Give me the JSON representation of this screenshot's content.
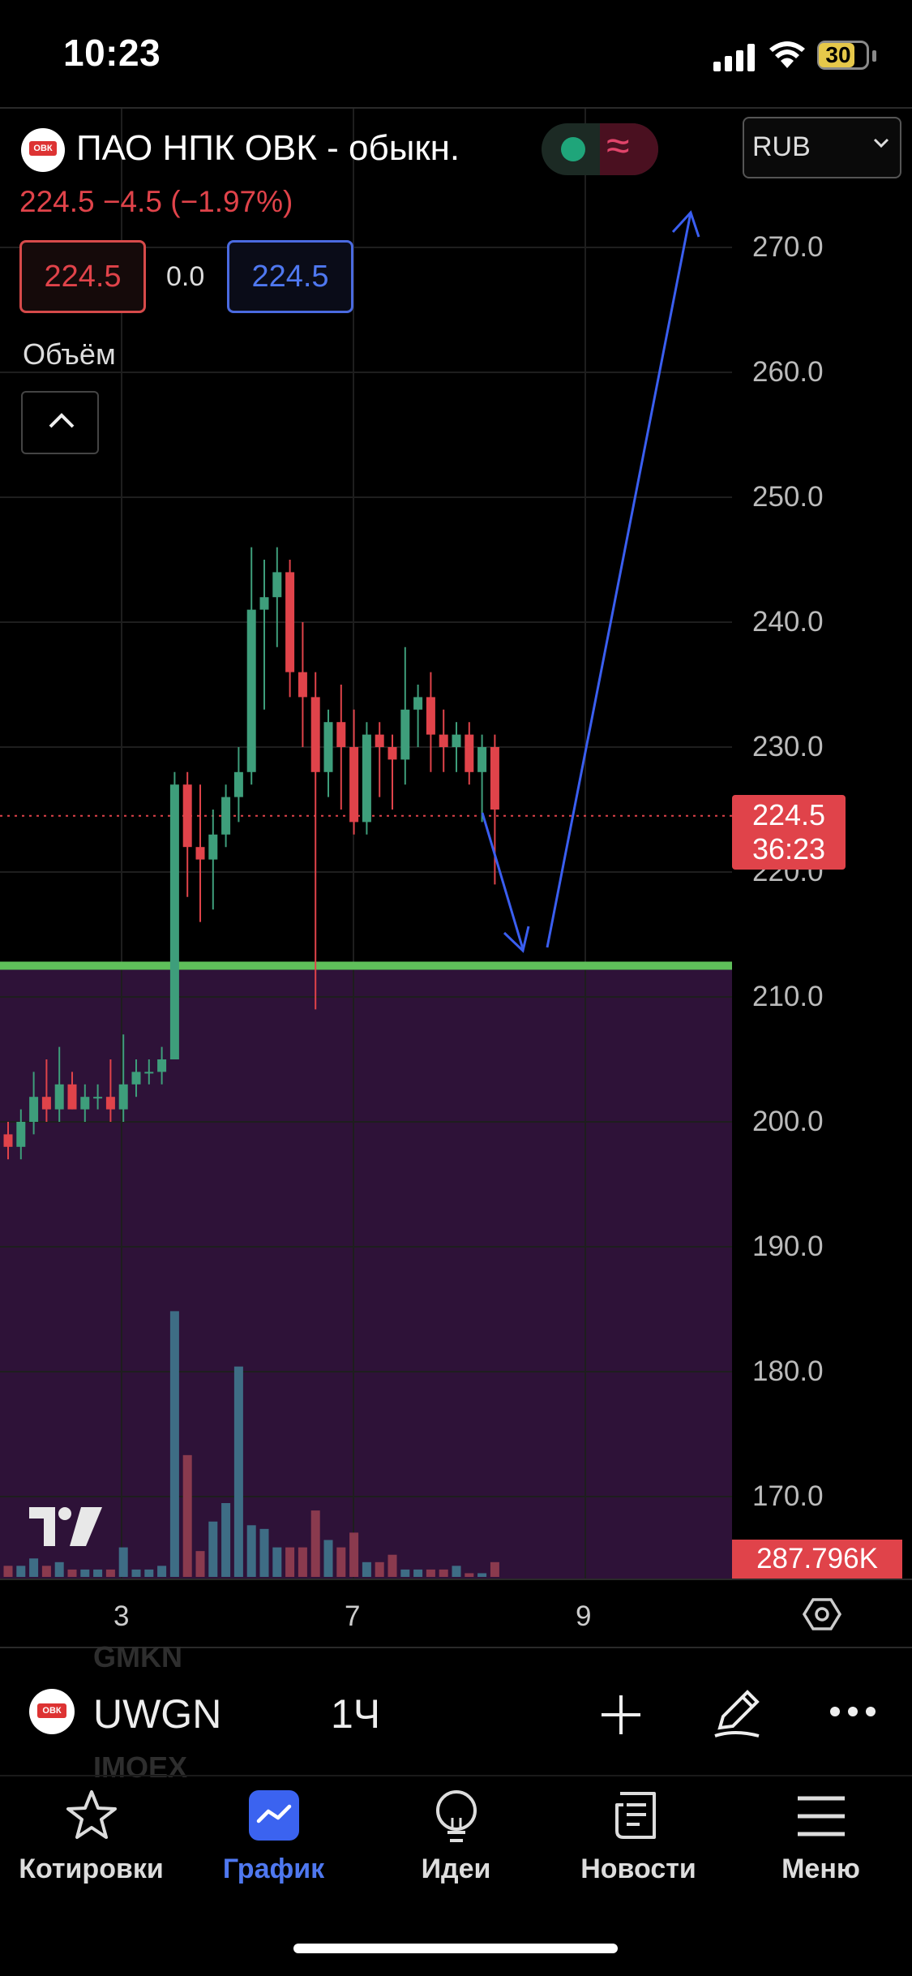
{
  "status_bar": {
    "time": "10:23",
    "battery": "30"
  },
  "header": {
    "logo_text": "ОВК",
    "title": "ПАО НПК ОВК - обыкн.",
    "status_wave": "≈",
    "price_line": "224.5  −4.5 (−1.97%)",
    "bid": "224.5",
    "spread": "0.0",
    "ask": "224.5",
    "volume_label": "Объём",
    "currency": "RUB"
  },
  "colors": {
    "up": "#3e9e7b",
    "down": "#e0434a",
    "support_line": "#5fbf5a",
    "zone": "#2e1238",
    "arrow": "#3a5ef0"
  },
  "chart_data": {
    "type": "candlestick",
    "y_ticks": [
      "270.0",
      "260.0",
      "250.0",
      "240.0",
      "230.0",
      "220.0",
      "210.0",
      "200.0",
      "190.0",
      "180.0",
      "170.0"
    ],
    "ylim": [
      165,
      278
    ],
    "x_ticks": [
      "3",
      "7",
      "9"
    ],
    "last_price": "224.5",
    "countdown": "36:23",
    "volume_value": "287.796K",
    "support_level": 212.5,
    "candles": [
      [
        199,
        200,
        197,
        198
      ],
      [
        198,
        201,
        197,
        200
      ],
      [
        200,
        204,
        199,
        202
      ],
      [
        202,
        205,
        200,
        201
      ],
      [
        201,
        206,
        200,
        203
      ],
      [
        203,
        204,
        201,
        201
      ],
      [
        201,
        203,
        200,
        202
      ],
      [
        202,
        203,
        201,
        202
      ],
      [
        202,
        205,
        200,
        201
      ],
      [
        201,
        207,
        200,
        203
      ],
      [
        203,
        205,
        202,
        204
      ],
      [
        204,
        205,
        203,
        204
      ],
      [
        204,
        206,
        203,
        205
      ],
      [
        205,
        228,
        205,
        227
      ],
      [
        227,
        228,
        218,
        222
      ],
      [
        222,
        227,
        216,
        221
      ],
      [
        221,
        225,
        217,
        223
      ],
      [
        223,
        227,
        222,
        226
      ],
      [
        226,
        230,
        224,
        228
      ],
      [
        228,
        246,
        227,
        241
      ],
      [
        241,
        245,
        233,
        242
      ],
      [
        242,
        246,
        238,
        244
      ],
      [
        244,
        245,
        234,
        236
      ],
      [
        236,
        240,
        230,
        234
      ],
      [
        234,
        236,
        209,
        228
      ],
      [
        228,
        233,
        226,
        232
      ],
      [
        232,
        235,
        225,
        230
      ],
      [
        230,
        233,
        223,
        224
      ],
      [
        224,
        232,
        223,
        231
      ],
      [
        231,
        232,
        226,
        230
      ],
      [
        230,
        231,
        225,
        229
      ],
      [
        229,
        238,
        227,
        233
      ],
      [
        233,
        235,
        230,
        234
      ],
      [
        234,
        236,
        228,
        231
      ],
      [
        231,
        233,
        228,
        230
      ],
      [
        230,
        232,
        228,
        231
      ],
      [
        231,
        232,
        227,
        228
      ],
      [
        228,
        231,
        224,
        230
      ],
      [
        230,
        231,
        219,
        225
      ]
    ],
    "volumes": [
      0.03,
      0.03,
      0.05,
      0.03,
      0.04,
      0.02,
      0.02,
      0.02,
      0.02,
      0.08,
      0.02,
      0.02,
      0.03,
      0.72,
      0.33,
      0.07,
      0.15,
      0.2,
      0.57,
      0.14,
      0.13,
      0.08,
      0.08,
      0.08,
      0.18,
      0.1,
      0.08,
      0.12,
      0.04,
      0.04,
      0.06,
      0.02,
      0.02,
      0.02,
      0.02,
      0.03,
      0.01,
      0.01,
      0.04
    ]
  },
  "toolbar": {
    "symbol": "UWGN",
    "interval": "1Ч",
    "ghost_top": "GMKN",
    "ghost_bottom": "IMOEX"
  },
  "nav": [
    {
      "label": "Котировки",
      "icon": "star-icon"
    },
    {
      "label": "График",
      "icon": "chart-icon",
      "active": true
    },
    {
      "label": "Идеи",
      "icon": "lightbulb-icon"
    },
    {
      "label": "Новости",
      "icon": "news-icon"
    },
    {
      "label": "Меню",
      "icon": "menu-icon"
    }
  ]
}
